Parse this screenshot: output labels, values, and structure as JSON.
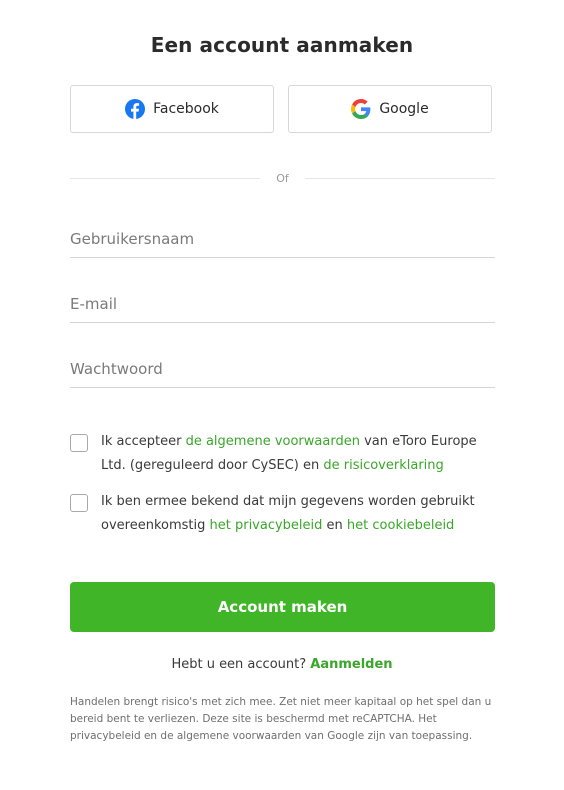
{
  "page": {
    "title": "Een account aanmaken"
  },
  "social": {
    "facebook_label": "Facebook",
    "google_label": "Google"
  },
  "divider": {
    "label": "Of"
  },
  "form": {
    "username_placeholder": "Gebruikersnaam",
    "email_placeholder": "E-mail",
    "password_placeholder": "Wachtwoord"
  },
  "consent": {
    "terms": {
      "prefix": "Ik accepteer ",
      "link1": "de algemene voorwaarden",
      "middle": " van eToro Europe Ltd. (gereguleerd door CySEC) en ",
      "link2": "de risicoverklaring"
    },
    "privacy": {
      "prefix": "Ik ben ermee bekend dat mijn gegevens worden gebruikt overeenkomstig ",
      "link1": "het privacybeleid",
      "middle": " en ",
      "link2": "het cookiebeleid"
    }
  },
  "submit": {
    "label": "Account maken"
  },
  "login": {
    "question": "Hebt u een account? ",
    "link": "Aanmelden"
  },
  "disclaimer": "Handelen brengt risico's met zich mee. Zet niet meer kapitaal op het spel dan u bereid bent te verliezen. Deze site is beschermd met reCAPTCHA. Het privacybeleid en de algemene voorwaarden van Google zijn van toepassing.",
  "colors": {
    "accent_green": "#40b528",
    "link_green": "#3aa62a",
    "facebook_blue": "#1877f2"
  }
}
